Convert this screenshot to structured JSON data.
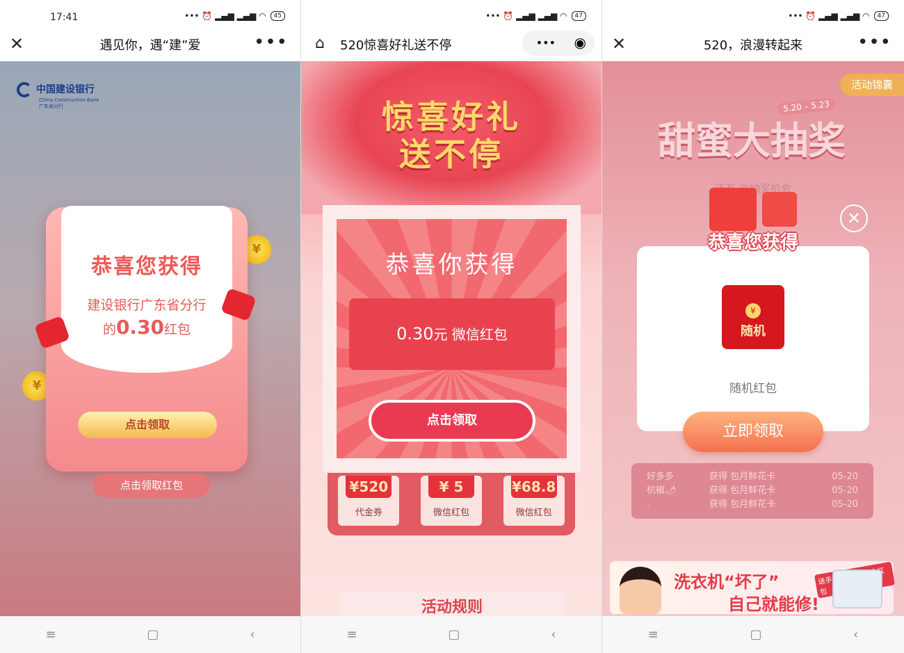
{
  "screens": [
    {
      "status": {
        "time": "17:41",
        "battery": "45"
      },
      "nav": {
        "title": "遇见你，遇“建”爱",
        "close": "✕",
        "more": "•••"
      },
      "bank": {
        "name": "中国建设银行",
        "en": "China Construction Bank",
        "branch": "广东省分行"
      },
      "card": {
        "heading": "恭喜您获得",
        "line1": "建设银行广东省分行",
        "line2_pre": "的",
        "amount": "0.30",
        "line2_post": "红包"
      },
      "claim_button": "点击领取",
      "bottom_button": "点击领取红包"
    },
    {
      "status": {
        "battery": "47"
      },
      "nav": {
        "title": "520惊喜好礼送不停",
        "home": "⌂",
        "more": "•••",
        "target": "◉"
      },
      "hero": {
        "line1": "惊喜好礼",
        "line2": "送不停"
      },
      "modal": {
        "heading": "恭喜你获得",
        "amount": "0.30",
        "amount_unit": "元 微信红包",
        "claim": "点击领取"
      },
      "coupons": [
        {
          "value": "¥520",
          "label": "代金券"
        },
        {
          "value": "¥ 5",
          "label": "微信红包"
        },
        {
          "value": "¥68.8",
          "label": "微信红包"
        }
      ],
      "rules": "活动规则"
    },
    {
      "status": {
        "battery": "47"
      },
      "nav": {
        "title": "520，浪漫转起来",
        "close": "✕",
        "more": "•••"
      },
      "tag": "活动锦囊",
      "title": "甜蜜大抽奖",
      "date": "5.20 – 5.23",
      "chance": "还有 次抽奖机会",
      "popup": {
        "heading": "恭喜您获得",
        "envelope_symbol": "¥",
        "envelope_text": "随机",
        "label": "随机红包",
        "claim": "立即领取",
        "close": "✕"
      },
      "winners": [
        {
          "name": "好多多",
          "prize": "获得 包月鲜花卡",
          "date": "05-20"
        },
        {
          "name": "杭椒🌶",
          "prize": "获得 包月鲜花卡",
          "date": "05-20"
        },
        {
          "name": ".",
          "prize": "获得 包月鲜花卡",
          "date": "05-20"
        }
      ],
      "banner": {
        "line1": "洗衣机“坏了”",
        "line2": "自己就能修!",
        "tag": "送手机 鲜花卡 现金红包"
      }
    }
  ],
  "system_nav": {
    "menu": "≡",
    "home": "▢",
    "back": "‹"
  },
  "colors": {
    "accent_red": "#e4323c",
    "pink": "#f48a8c",
    "gold": "#f4b94b"
  }
}
